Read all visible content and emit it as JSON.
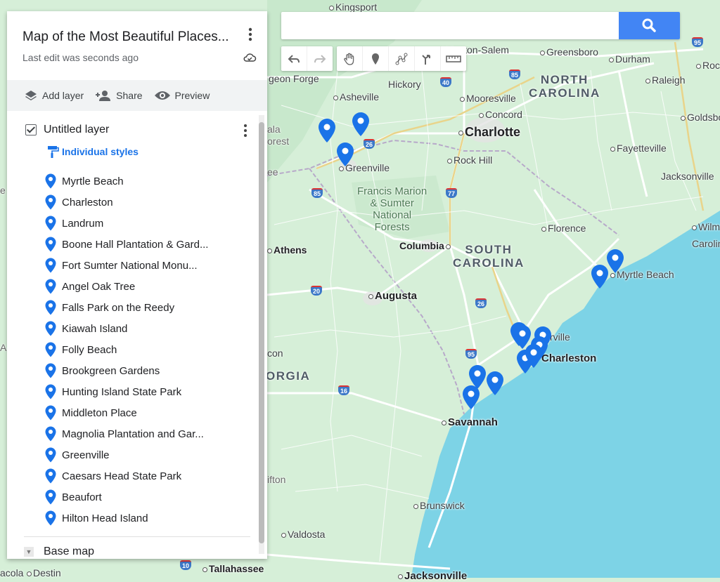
{
  "panel": {
    "title": "Map of the Most Beautiful Places...",
    "subtitle": "Last edit was seconds ago",
    "actions": {
      "add_layer": "Add layer",
      "share": "Share",
      "preview": "Preview"
    },
    "layer": {
      "name": "Untitled layer",
      "style": "Individual styles",
      "items": [
        "Myrtle Beach",
        "Charleston",
        "Landrum",
        "Boone Hall Plantation & Gard...",
        "Fort Sumter National Monu...",
        "Angel Oak Tree",
        "Falls Park on the Reedy",
        "Kiawah Island",
        "Folly Beach",
        "Brookgreen Gardens",
        "Hunting Island State Park",
        "Middleton Place",
        "Magnolia Plantation and Gar...",
        "Greenville",
        "Caesars Head State Park",
        "Beaufort",
        "Hilton Head Island"
      ]
    },
    "base_map": "Base map"
  },
  "search": {
    "value": "",
    "placeholder": ""
  },
  "toolbar": {
    "icons": [
      "undo-icon",
      "redo-icon",
      "hand-icon",
      "add-marker-icon",
      "draw-line-icon",
      "directions-icon",
      "measure-icon"
    ]
  },
  "map": {
    "places": {
      "kingsport": "Kingsport",
      "winston_salem": "Winston-Salem",
      "greensboro": "Greensboro",
      "durham": "Durham",
      "roc": "Roc",
      "pigeon_forge": "geon Forge",
      "hickory": "Hickory",
      "raleigh": "Raleigh",
      "asheville": "Asheville",
      "mooresville": "Mooresville",
      "concord": "Concord",
      "goldsbo": "Goldsbo",
      "charlotte": "Charlotte",
      "fayetteville": "Fayetteville",
      "rock_hill": "Rock Hill",
      "greenville": "Greenville",
      "jacksonville_nc": "Jacksonville",
      "florence": "Florence",
      "wilm": "Wilm",
      "carolin": "Carolin",
      "athens": "Athens",
      "columbia": "Columbia",
      "myrtle_beach": "Myrtle Beach",
      "augusta": "Augusta",
      "summerville_part": "rville",
      "charleston": "Charleston",
      "savannah": "Savannah",
      "brunswick": "Brunswick",
      "valdosta": "Valdosta",
      "tallahassee": "Tallahassee",
      "jacksonville_fl": "Jacksonville",
      "pensacola_part": "acola",
      "destin": "Destin",
      "macon_part": "con",
      "tifton_part": "ifton",
      "ala_part": "ala",
      "orest_part": "orest",
      "ee_part": "ee",
      "e_part": "e",
      "a_part": "A"
    },
    "states": {
      "north_carolina": [
        "NORTH",
        "CAROLINA"
      ],
      "south_carolina": [
        "SOUTH",
        "CAROLINA"
      ],
      "georgia_part": "ORGIA"
    },
    "forest": [
      "Francis Marion",
      "& Sumter",
      "National",
      "Forests"
    ],
    "shields": [
      "95",
      "85",
      "40",
      "85",
      "26",
      "77",
      "85",
      "20",
      "26",
      "95",
      "16",
      "95",
      "10",
      "10"
    ]
  },
  "colors": {
    "pin": "#1a73e8",
    "ocean": "#7dd3e6",
    "land": "#d6efd8",
    "search_button": "#4285f4",
    "accent_text": "#1a73e8"
  }
}
